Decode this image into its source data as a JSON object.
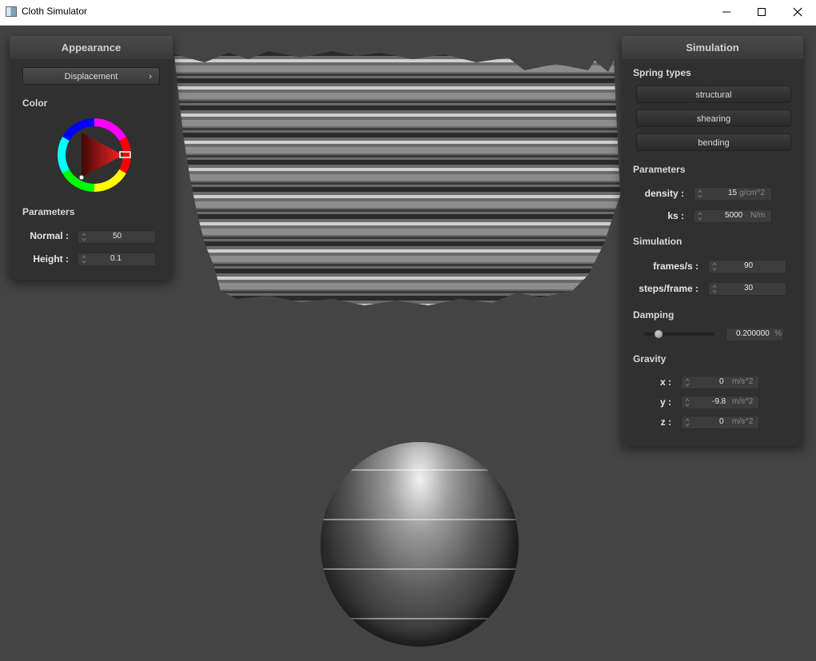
{
  "window": {
    "title": "Cloth Simulator",
    "controls": {
      "minimize": "minimize-icon",
      "maximize": "maximize-icon",
      "close": "close-icon"
    }
  },
  "appearance": {
    "header": "Appearance",
    "shader_dropdown": "Displacement",
    "color_label": "Color",
    "parameters_label": "Parameters",
    "normal": {
      "label": "Normal :",
      "value": "50"
    },
    "height": {
      "label": "Height :",
      "value": "0.1"
    }
  },
  "simulation": {
    "header": "Simulation",
    "spring_types_label": "Spring types",
    "spring_buttons": [
      "structural",
      "shearing",
      "bending"
    ],
    "parameters_label": "Parameters",
    "density": {
      "label": "density :",
      "value": "15",
      "unit": "g/cm^2"
    },
    "ks": {
      "label": "ks :",
      "value": "5000",
      "unit": "N/m"
    },
    "simulation_label": "Simulation",
    "frames": {
      "label": "frames/s :",
      "value": "90"
    },
    "steps": {
      "label": "steps/frame :",
      "value": "30"
    },
    "damping_label": "Damping",
    "damping": {
      "value": "0.200000",
      "unit": "%",
      "slider_fraction": 0.2
    },
    "gravity_label": "Gravity",
    "gravity_x": {
      "label": "x :",
      "value": "0",
      "unit": "m/s^2"
    },
    "gravity_y": {
      "label": "y :",
      "value": "-9.8",
      "unit": "m/s^2"
    },
    "gravity_z": {
      "label": "z :",
      "value": "0",
      "unit": "m/s^2"
    }
  },
  "colors": {
    "background": "#444444",
    "panel": "#303030",
    "color_wheel_selected": "#ff0000"
  }
}
